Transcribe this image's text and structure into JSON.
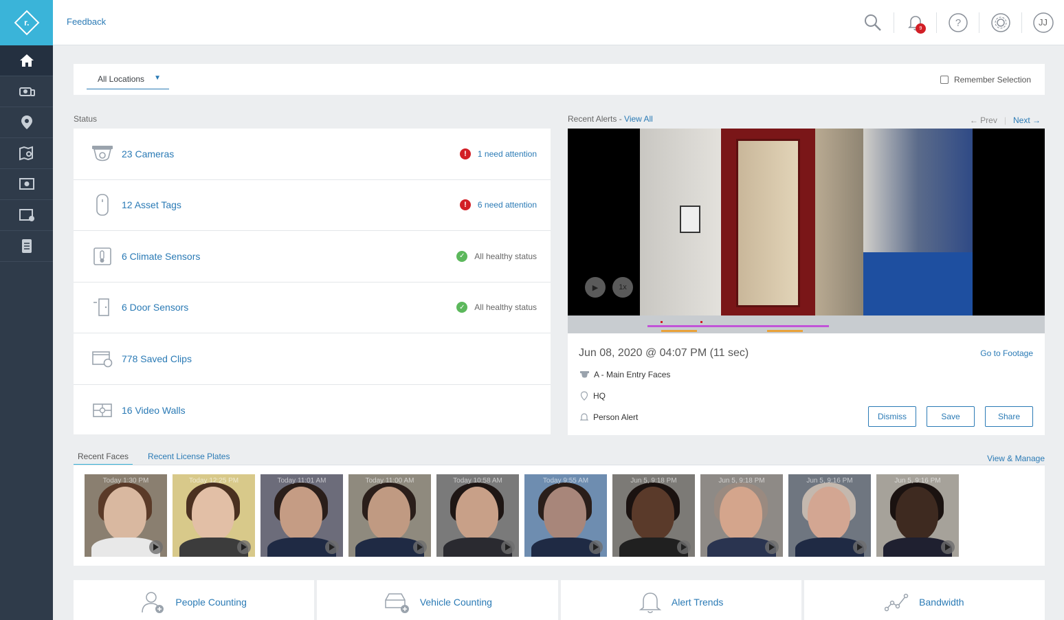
{
  "topbar": {
    "feedback": "Feedback",
    "notification_count": "9",
    "user_initials": "JJ"
  },
  "locbar": {
    "selected_location": "All Locations",
    "remember_label": "Remember Selection"
  },
  "status": {
    "label": "Status",
    "rows": [
      {
        "title": "23 Cameras",
        "state": "1 need attention",
        "kind": "attention"
      },
      {
        "title": "12 Asset Tags",
        "state": "6 need attention",
        "kind": "attention"
      },
      {
        "title": "6 Climate Sensors",
        "state": "All healthy status",
        "kind": "healthy"
      },
      {
        "title": "6 Door Sensors",
        "state": "All healthy status",
        "kind": "healthy"
      },
      {
        "title": "778 Saved Clips",
        "state": "",
        "kind": "none"
      },
      {
        "title": "16 Video Walls",
        "state": "",
        "kind": "none"
      }
    ]
  },
  "alerts": {
    "label": "Recent Alerts - ",
    "view_all": "View All",
    "prev": "← Prev",
    "next": "Next →",
    "speed": "1x",
    "time": "Jun 08, 2020 @ 04:07 PM (11 sec)",
    "goto": "Go to Footage",
    "camera": "A - Main Entry Faces",
    "location": "HQ",
    "alert_type": "Person Alert",
    "buttons": {
      "dismiss": "Dismiss",
      "save": "Save",
      "share": "Share"
    }
  },
  "faces": {
    "tab_faces": "Recent Faces",
    "tab_plates": "Recent License Plates",
    "view_manage": "View & Manage",
    "items": [
      {
        "time": "Today 1:30 PM",
        "bg": "#8a7f70",
        "skin": "#d9b8a0",
        "hair": "#5a3a28",
        "body": "#e8e8e8"
      },
      {
        "time": "Today 12:25 PM",
        "bg": "#d8c98a",
        "skin": "#e2bfa6",
        "hair": "#4a3020",
        "body": "#3c3c3c"
      },
      {
        "time": "Today 11:01 AM",
        "bg": "#6c6c7a",
        "skin": "#c59c84",
        "hair": "#2a1e1a",
        "body": "#1f2a44"
      },
      {
        "time": "Today 11:00 AM",
        "bg": "#8f8a7e",
        "skin": "#c09a82",
        "hair": "#2a1e1a",
        "body": "#1f2a44"
      },
      {
        "time": "Today 10:58 AM",
        "bg": "#7a7a7a",
        "skin": "#c8a088",
        "hair": "#1e1614",
        "body": "#2a2a30"
      },
      {
        "time": "Today 9:55 AM",
        "bg": "#6e8db0",
        "skin": "#a8867a",
        "hair": "#2a1e1a",
        "body": "#1f2a44"
      },
      {
        "time": "Jun 5, 9:18 PM",
        "bg": "#7c7a76",
        "skin": "#5a3a2a",
        "hair": "#1a1210",
        "body": "#202020"
      },
      {
        "time": "Jun 5, 9:18 PM",
        "bg": "#8e8a86",
        "skin": "#d4a58c",
        "hair": "#9a8a80",
        "body": "#2a3450"
      },
      {
        "time": "Jun 5, 9:16 PM",
        "bg": "#6f7680",
        "skin": "#d3a692",
        "hair": "#c4b8ae",
        "body": "#1f2a44"
      },
      {
        "time": "Jun 5, 9:16 PM",
        "bg": "#a6a29a",
        "skin": "#3e2a20",
        "hair": "#1a1210",
        "body": "#1f2030"
      }
    ]
  },
  "tiles": [
    {
      "label": "People Counting",
      "icon": "people-counting-icon"
    },
    {
      "label": "Vehicle Counting",
      "icon": "vehicle-counting-icon"
    },
    {
      "label": "Alert Trends",
      "icon": "bell-icon"
    },
    {
      "label": "Bandwidth",
      "icon": "bandwidth-icon"
    }
  ],
  "colors": {
    "accent": "#2a7ab5",
    "brand": "#3ab4d9",
    "sidebar": "#2f3b4a",
    "danger": "#d21f26",
    "ok": "#5cb85c"
  }
}
